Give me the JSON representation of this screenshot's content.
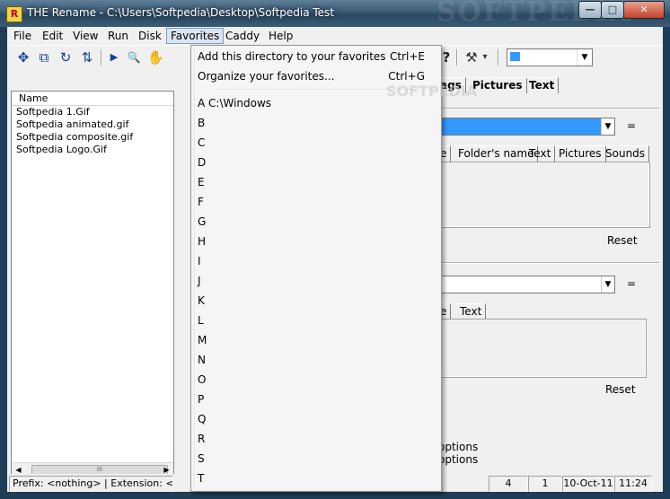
{
  "window": {
    "title": "THE Rename - C:\\Users\\Softpedia\\Desktop\\Softpedia Test",
    "app_icon_letter": "R",
    "watermark": "SOFTPEDIA",
    "controls": {
      "minimize": "—",
      "maximize": "□",
      "close": "✕"
    }
  },
  "menubar": [
    "File",
    "Edit",
    "View",
    "Run",
    "Disk",
    "Favorites",
    "Caddy",
    "Help"
  ],
  "toolbar": {
    "icons": [
      "move-icon",
      "copy-icon",
      "refresh-icon",
      "toggle-icon",
      "play-icon",
      "preview-icon",
      "hand-icon",
      "help-icon",
      "tools-icon"
    ],
    "glyphs": {
      "move": "✥",
      "copy": "⧉",
      "refresh": "↻",
      "toggle": "⇅",
      "play": "▶",
      "preview": "🔍",
      "hand": "✋",
      "help": "?",
      "tools": "⚒",
      "dropdown": "▾"
    },
    "combo_arrow": "▼"
  },
  "filelist": {
    "column_header": "Name",
    "files": [
      "Softpedia 1.Gif",
      "Softpedia animated.gif",
      "Softpedia composite.gif",
      "Softpedia Logo.Gif"
    ],
    "scroll_thumb": "III",
    "scroll_left": "◀",
    "scroll_right": "▶"
  },
  "right_panel": {
    "top_tabs": [
      "ags",
      "Pictures",
      "Text"
    ],
    "group1": {
      "equals": "=",
      "tabs": [
        "e",
        "Folder's name",
        "Text",
        "Pictures",
        "Sounds"
      ],
      "reset": "Reset",
      "combo_arrow": "▼"
    },
    "group2": {
      "equals": "=",
      "tabs": [
        "e",
        "Text"
      ],
      "reset": "Reset",
      "combo_arrow": "▼"
    },
    "options": [
      "options",
      "options"
    ]
  },
  "statusbar": {
    "prefix_text": "Prefix: <nothing> | Extension: <nothin",
    "cells": [
      "4",
      "1",
      "10-Oct-11",
      "11:24"
    ]
  },
  "favorites_menu": {
    "watermark": "SOFTPEDIA",
    "items": [
      {
        "label": "Add this directory to your favorites",
        "shortcut": "Ctrl+E"
      },
      {
        "label": "Organize your favorites...",
        "shortcut": "Ctrl+G"
      }
    ],
    "favorites": [
      "A C:\\Windows",
      "B",
      "C",
      "D",
      "E",
      "F",
      "G",
      "H",
      "I",
      "J",
      "K",
      "L",
      "M",
      "N",
      "O",
      "P",
      "Q",
      "R",
      "S",
      "T"
    ]
  },
  "colors": {
    "selection": "#3399ff",
    "title_bar": "#3b5a74",
    "menu_active": "#dbe5f1"
  }
}
